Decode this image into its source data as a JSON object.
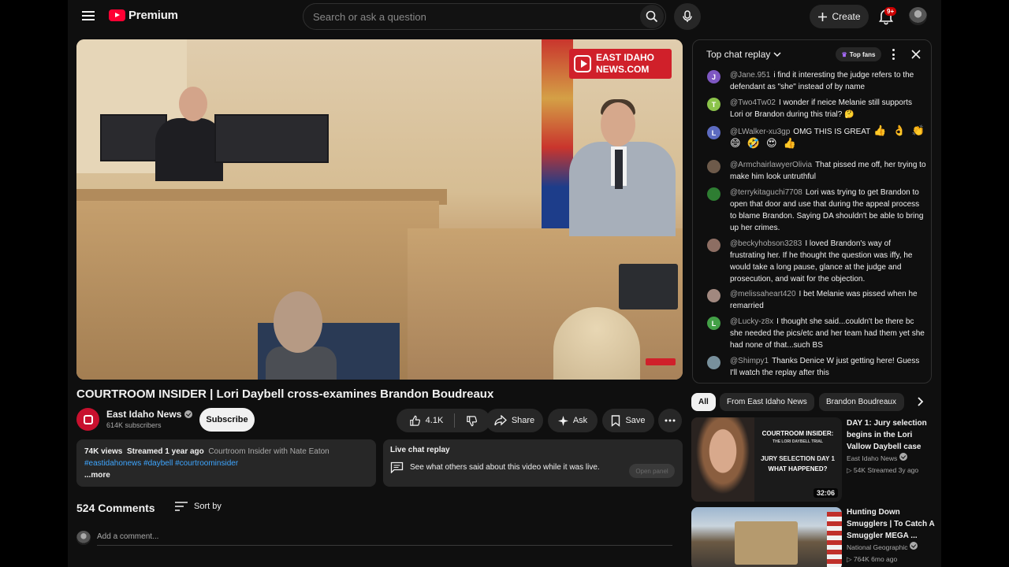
{
  "header": {
    "logo_text": "Premium",
    "search_placeholder": "Search or ask a question",
    "create_label": "Create",
    "notification_badge": "9+"
  },
  "video": {
    "watermark_line1": "EAST IDAHO",
    "watermark_line2": "NEWS.COM",
    "title": "COURTROOM INSIDER | Lori Daybell cross-examines Brandon Boudreaux",
    "channel_name": "East Idaho News",
    "channel_avatar_text": "EAST IDAHO NEWS",
    "subscribers": "614K subscribers",
    "subscribe_label": "Subscribe",
    "likes": "4.1K",
    "share_label": "Share",
    "ask_label": "Ask",
    "save_label": "Save"
  },
  "description": {
    "views": "74K views",
    "streamed": "Streamed 1 year ago",
    "series": "Courtroom Insider with Nate Eaton",
    "hashtags": [
      "#eastidahonews",
      "#daybell",
      "#courtroominsider"
    ],
    "more_label": "...more"
  },
  "live_chat_card": {
    "title": "Live chat replay",
    "text": "See what others said about this video while it was live.",
    "button_label": "Open panel"
  },
  "comments": {
    "count_label": "524 Comments",
    "sort_label": "Sort by",
    "add_placeholder": "Add a comment..."
  },
  "chat": {
    "title": "Top chat replay",
    "top_fans_label": "Top fans",
    "messages": [
      {
        "user": "@Jane.951",
        "initial": "J",
        "color": "#7e57c2",
        "text": "i find it interesting the judge refers to the defendant as \"she\" instead of by name"
      },
      {
        "user": "@Two4Tw02",
        "initial": "T",
        "color": "#8bc34a",
        "text": "I wonder if neice Melanie still supports Lori or Brandon during this trial? 🤔"
      },
      {
        "user": "@LWalker-xu3gp",
        "initial": "L",
        "color": "#5c6bc0",
        "text": "OMG THIS IS GREAT",
        "emoji": "👍 👌 👏 😄 🤣 😍 👍"
      },
      {
        "user": "@ArmchairlawyerOlivia",
        "initial": "",
        "color": "#6d5a4a",
        "text": "That pissed me off, her trying to make him look untruthful"
      },
      {
        "user": "@terrykitaguchi7708",
        "initial": "",
        "color": "#2e7d32",
        "text": "Lori was trying to get Brandon to open that door and use that during the appeal process to blame Brandon. Saying DA shouldn't be able to bring up her crimes."
      },
      {
        "user": "@beckyhobson3283",
        "initial": "",
        "color": "#8d6e63",
        "text": "I loved Brandon's way of frustrating her. If he thought the question was iffy, he would take a long pause, glance at the judge and prosecution, and wait for the objection."
      },
      {
        "user": "@melissaheart420",
        "initial": "",
        "color": "#a1887f",
        "text": "I bet Melanie was pissed when he remarried"
      },
      {
        "user": "@Lucky-z8x",
        "initial": "L",
        "color": "#43a047",
        "text": "I thought she said...couldn't be there bc she needed the pics/etc and her team had them yet she had none of that...such BS"
      },
      {
        "user": "@Shimpy1",
        "initial": "",
        "color": "#78909c",
        "text": "Thanks Denice W just getting here! Guess I'll watch the replay after this"
      }
    ]
  },
  "chips": [
    "All",
    "From East Idaho News",
    "Brandon Boudreaux"
  ],
  "recommended": [
    {
      "title": "DAY 1: Jury selection begins in the Lori Vallow Daybell case",
      "channel": "East Idaho News",
      "meta": "54K  Streamed 3y ago",
      "duration": "32:06",
      "thumb_line1": "COURTROOM INSIDER:",
      "thumb_line2": "THE LORI DAYBELL TRIAL",
      "thumb_line3": "JURY SELECTION DAY 1",
      "thumb_line4": "WHAT HAPPENED?"
    },
    {
      "title": "Hunting Down Smugglers | To Catch A Smuggler MEGA ...",
      "channel": "National Geographic",
      "meta": "764K  6mo ago"
    }
  ]
}
